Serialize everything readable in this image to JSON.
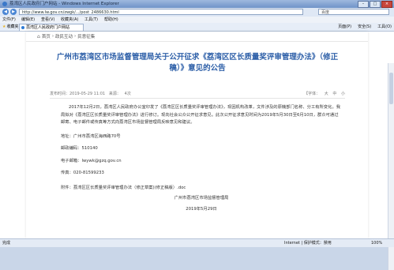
{
  "window": {
    "title": "荔湾区人民政府门户网站 - Windows Internet Explorer"
  },
  "address": {
    "url": "http://www.lw.gov.cn/zwgk/.../post_2486630.html",
    "search_placeholder": "百度"
  },
  "menu": [
    "文件(F)",
    "编辑(E)",
    "查看(V)",
    "收藏夹(A)",
    "工具(T)",
    "帮助(H)"
  ],
  "favorites": {
    "label": "收藏夹",
    "tab": "荔湾区人民政府门户网站"
  },
  "commands": [
    "页面(P)",
    "安全(S)",
    "工具(O)"
  ],
  "breadcrumb": [
    "首页",
    "政民互动",
    "民意征集"
  ],
  "article": {
    "title": "广州市荔湾区市场监督管理局关于公开征求《荔湾区区长质量奖评审管理办法》（修正稿）》意见的公告",
    "date": "发布时间：2019-05-29 11:01",
    "source": "来源：",
    "views": "4次",
    "font_label": "【字体：",
    "font_sizes": [
      "大",
      "中",
      "小"
    ],
    "para1": "2017年12月2日，荔湾区人民政府办公室印发了《荔湾区区长质量奖评审管理办法》，现因机构改革，文件涉及的原機部门名称、分工有所变化。我局拟对《荔湾区区长质量奖评审管理办法》进行修订。现向社会公众公开征求意见。此次公开征求意见时间为2019年5月30日至6月10日，群众可通过邮寄、电子邮件或传真等方式向荔湾区市场监督管理局反映意见和建议。",
    "address": "地址：广州市荔湾区海西路70号",
    "postcode": "邮政编码：510140",
    "email": "电子邮箱：lwywk@gzq.gov.cn",
    "fax": "传真：020-81599233",
    "attachment": "附件：荔湾区区长质量奖评审管理办法（修正草案)(修正稿版）.doc",
    "org": "广州市荔湾区市场监督管理局",
    "sign_date": "2019年5月29日"
  },
  "status": {
    "left": "完成",
    "zone": "Internet | 保护模式：禁用",
    "zoom": "100%"
  }
}
